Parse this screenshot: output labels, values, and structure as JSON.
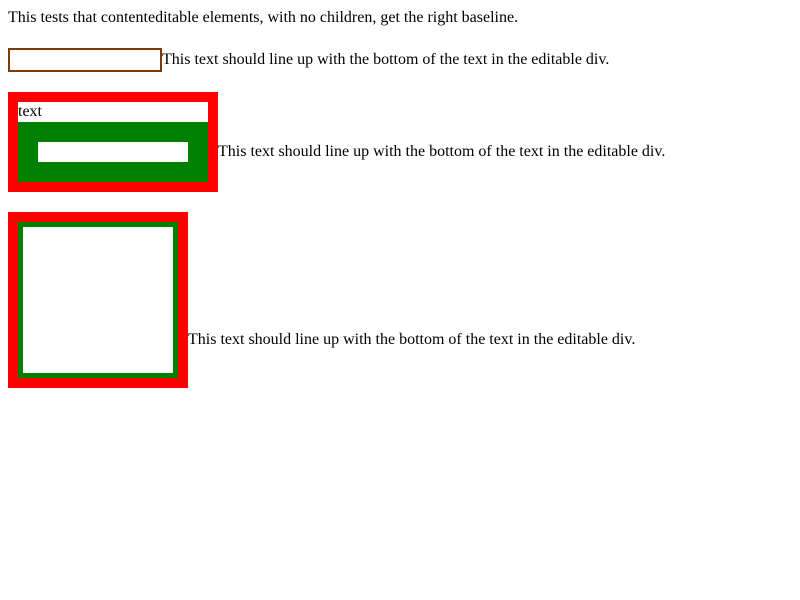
{
  "intro": "This tests that contenteditable elements, with no children, get the right baseline.",
  "rows": [
    {
      "label": "This text should line up with the bottom of the text in the editable div."
    },
    {
      "editable_text": "text",
      "label": "This text should line up with the bottom of the text in the editable div."
    },
    {
      "label": "This text should line up with the bottom of the text in the editable div."
    }
  ],
  "colors": {
    "border_brown": "#7a3a00",
    "border_red": "#ff0000",
    "fill_green": "#008000",
    "background": "#ffffff"
  }
}
